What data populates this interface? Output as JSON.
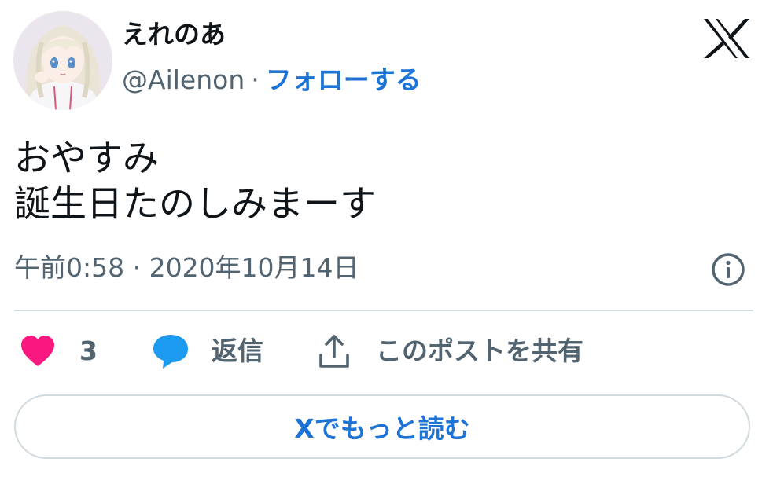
{
  "author": {
    "display_name": "えれのあ",
    "handle": "@Ailenon",
    "separator": "·",
    "follow_label": "フォローする"
  },
  "tweet": {
    "lines": [
      "おやすみ",
      "誕生日たのしみまーす"
    ],
    "timestamp": "午前0:58 · 2020年10月14日"
  },
  "actions": {
    "like_count": "3",
    "reply_label": "返信",
    "share_label": "このポストを共有"
  },
  "read_more_label": "Xでもっと読む",
  "colors": {
    "accent": "#1d73d6",
    "like": "#f91880",
    "reply": "#1d9bf0",
    "secondary_text": "#536471",
    "border": "#cfd9de"
  },
  "icons": {
    "logo": "x-logo-icon",
    "info": "info-icon",
    "like": "heart-icon",
    "reply": "speech-bubble-icon",
    "share": "share-upload-icon"
  }
}
